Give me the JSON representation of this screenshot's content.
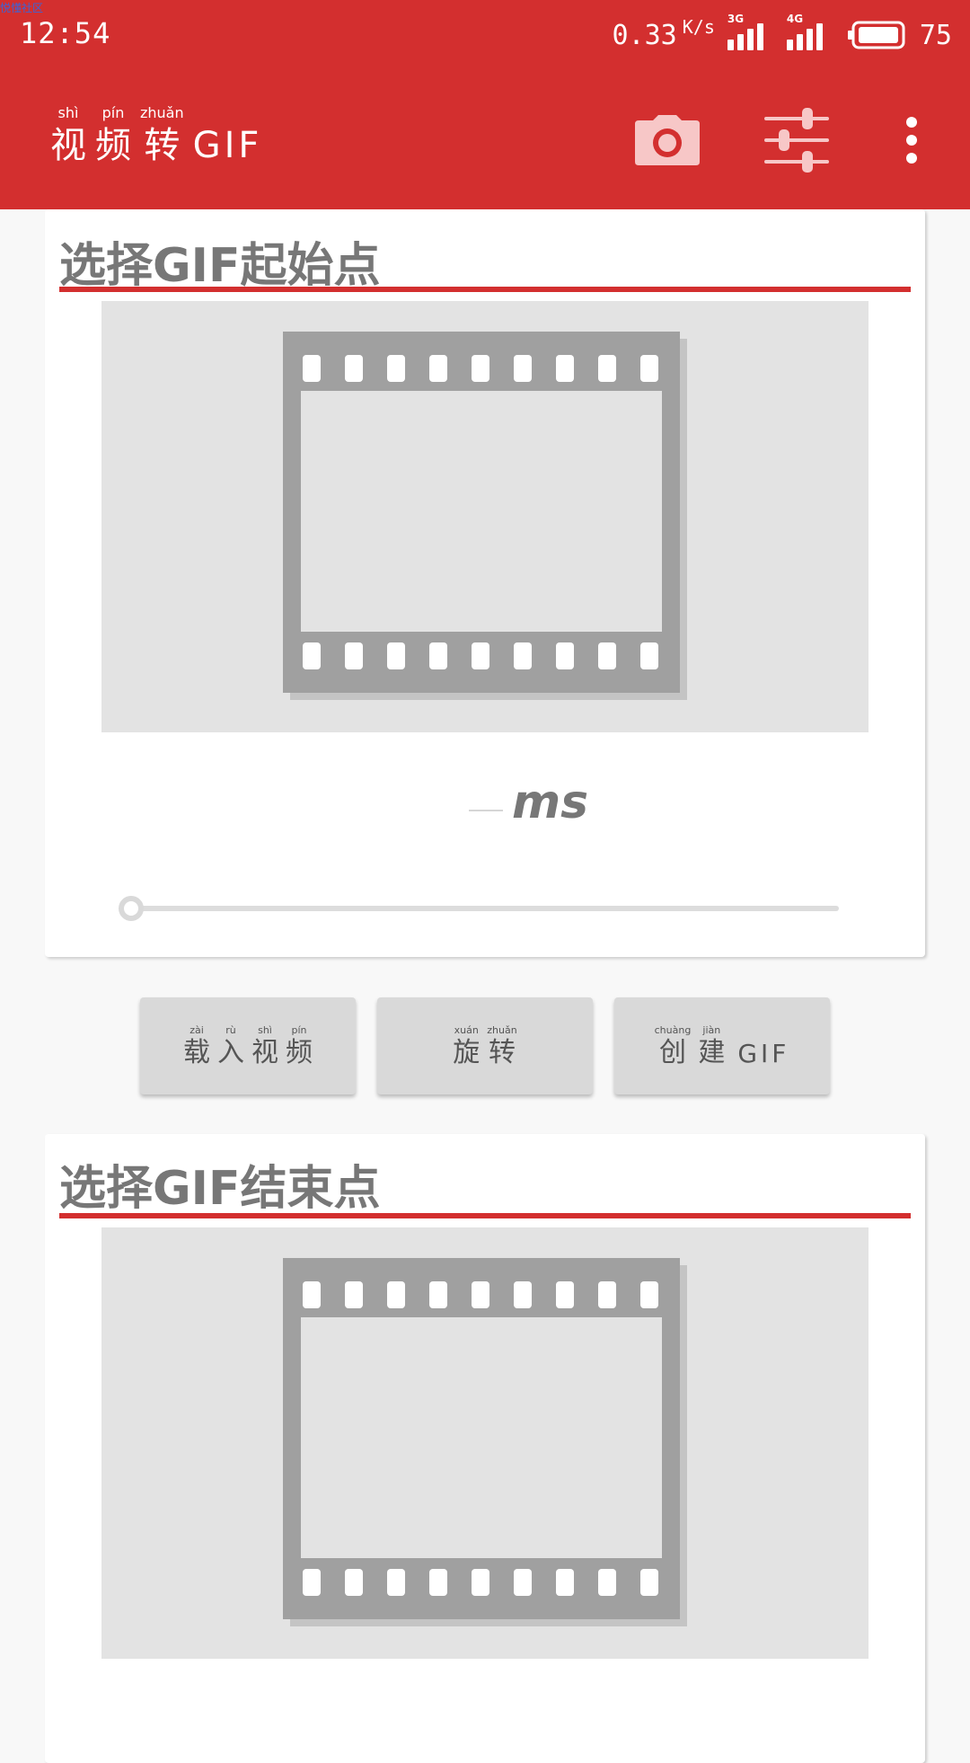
{
  "status_bar": {
    "watermark": "悦懂社区",
    "time": "12:54",
    "net_speed": "0.33",
    "net_unit": "K/s",
    "signal_1_label": "3G",
    "signal_2_label": "4G",
    "battery": "75"
  },
  "app_bar": {
    "title_chars": [
      {
        "pinyin": "shì",
        "hanzi": "视"
      },
      {
        "pinyin": "pín",
        "hanzi": "频"
      },
      {
        "pinyin": "zhuǎn",
        "hanzi": "转"
      }
    ],
    "title_latin": "GIF",
    "actions": [
      "camera-icon",
      "tune-icon",
      "more-vert-icon"
    ]
  },
  "start_section": {
    "title": "选择GIF起始点",
    "ms_value": "",
    "ms_unit": "ms",
    "seek_position": 0
  },
  "buttons": {
    "load_video": {
      "chars": [
        {
          "pinyin": "zài",
          "hanzi": "载"
        },
        {
          "pinyin": "rù",
          "hanzi": "入"
        },
        {
          "pinyin": "shì",
          "hanzi": "视"
        },
        {
          "pinyin": "pín",
          "hanzi": "频"
        }
      ]
    },
    "rotate": {
      "chars": [
        {
          "pinyin": "xuán",
          "hanzi": "旋"
        },
        {
          "pinyin": "zhuǎn",
          "hanzi": "转"
        }
      ]
    },
    "create_gif": {
      "chars": [
        {
          "pinyin": "chuàng",
          "hanzi": "创"
        },
        {
          "pinyin": "jiàn",
          "hanzi": "建"
        }
      ],
      "latin": "GIF"
    }
  },
  "end_section": {
    "title": "选择GIF结束点"
  },
  "colors": {
    "primary": "#d32f2f",
    "card_text": "#777777",
    "preview_bg": "#e3e3e3",
    "film_gray": "#a0a0a0"
  }
}
